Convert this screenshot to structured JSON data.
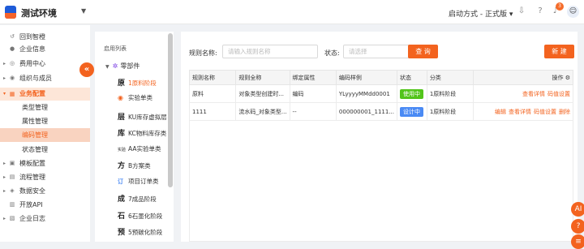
{
  "header": {
    "app_title": "测试环境",
    "launch_mode": "启动方式 - 正式版",
    "notification_count": "3",
    "icons": [
      "download-icon",
      "help-icon",
      "bell-icon",
      "avatar-icon"
    ]
  },
  "sidebar": {
    "collapse_glyph": "«",
    "items": [
      {
        "label": "回到智橙",
        "icon": "↺"
      },
      {
        "label": "企业信息",
        "icon": "●"
      },
      {
        "label": "费用中心",
        "icon": "◎",
        "arrow": "▸"
      },
      {
        "label": "组织与成员",
        "icon": "◉",
        "arrow": "▸"
      },
      {
        "label": "业务配置",
        "icon": "▦",
        "arrow": "▾"
      },
      {
        "label": "类型管理"
      },
      {
        "label": "属性管理"
      },
      {
        "label": "编码管理"
      },
      {
        "label": "状态管理"
      },
      {
        "label": "模板配置",
        "icon": "▣",
        "arrow": "▸"
      },
      {
        "label": "流程管理",
        "icon": "▤",
        "arrow": "▸"
      },
      {
        "label": "数据安全",
        "icon": "◈",
        "arrow": "▸"
      },
      {
        "label": "开放API",
        "icon": "▥"
      },
      {
        "label": "企业日志",
        "icon": "▧",
        "arrow": "▸"
      }
    ]
  },
  "tree": {
    "title": "启用列表",
    "root": "零部件",
    "nodes": [
      {
        "glyph": "原",
        "label": "1原料阶段"
      },
      {
        "glyph": "◉",
        "label": "实验单类"
      },
      {
        "glyph": "层",
        "label": "KU库存虚拟层"
      },
      {
        "glyph": "库",
        "label": "KC物料库存类"
      },
      {
        "glyph": "实验",
        "label": "AA实验单类"
      },
      {
        "glyph": "方",
        "label": "B方案类"
      },
      {
        "glyph": "订",
        "label": "项目订单类"
      },
      {
        "glyph": "成",
        "label": "7成品阶段"
      },
      {
        "glyph": "石",
        "label": "6石墨化阶段"
      },
      {
        "glyph": "预",
        "label": "5预碳化阶段"
      }
    ]
  },
  "filters": {
    "rule_name_label": "规则名称:",
    "rule_name_placeholder": "请输入规则名称",
    "status_label": "状态:",
    "status_placeholder": "请选择",
    "query_button": "查 询",
    "new_button": "新 建"
  },
  "table": {
    "columns": [
      "规则名称",
      "规则全称",
      "绑定属性",
      "编码样例",
      "状态",
      "分类",
      "操作"
    ],
    "rows": [
      {
        "name": "原料",
        "full": "对象类型创建时...",
        "attr": "编码",
        "sample": "YLyyyyMMdd0001",
        "status": "使用中",
        "category": "1原料阶段",
        "ops": [
          "查看详情",
          "码值设置"
        ]
      },
      {
        "name": "1111",
        "full": "流水码_对象类型...",
        "attr": "--",
        "sample": "000000001_1111...",
        "status": "设计中",
        "category": "1原料阶段",
        "ops": [
          "编辑",
          "查看详情",
          "码值设置",
          "删除"
        ]
      }
    ]
  },
  "floaters": [
    {
      "label": "AI",
      "color": "#f3631f"
    },
    {
      "label": "?",
      "color": "#f3631f"
    },
    {
      "label": "≡",
      "color": "#f3631f"
    }
  ],
  "colors": {
    "accent": "#f3631f",
    "success": "#52c41a",
    "info": "#4a8af4"
  }
}
